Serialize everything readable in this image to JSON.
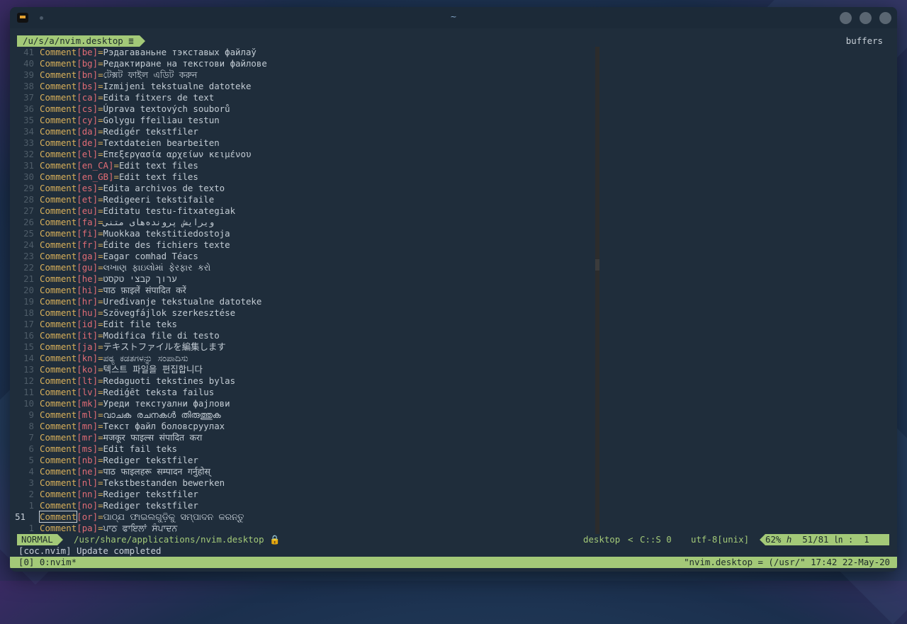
{
  "window": {
    "title": "~"
  },
  "tabline": {
    "path": "/u/s/a/nvim.desktop",
    "icon": "file-lines-icon",
    "buffers_label": "buffers"
  },
  "lines": [
    {
      "num": "41",
      "key": "Comment",
      "lang": "be",
      "val": "Рэдагаваньне тэкставых файлаў"
    },
    {
      "num": "40",
      "key": "Comment",
      "lang": "bg",
      "val": "Редактиране на текстови файлове"
    },
    {
      "num": "39",
      "key": "Comment",
      "lang": "bn",
      "val": "টেক্সট ফাইল এডিট করুন"
    },
    {
      "num": "38",
      "key": "Comment",
      "lang": "bs",
      "val": "Izmijeni tekstualne datoteke"
    },
    {
      "num": "37",
      "key": "Comment",
      "lang": "ca",
      "val": "Edita fitxers de text"
    },
    {
      "num": "36",
      "key": "Comment",
      "lang": "cs",
      "val": "Úprava textových souborů"
    },
    {
      "num": "35",
      "key": "Comment",
      "lang": "cy",
      "val": "Golygu ffeiliau testun"
    },
    {
      "num": "34",
      "key": "Comment",
      "lang": "da",
      "val": "Redigér tekstfiler"
    },
    {
      "num": "33",
      "key": "Comment",
      "lang": "de",
      "val": "Textdateien bearbeiten"
    },
    {
      "num": "32",
      "key": "Comment",
      "lang": "el",
      "val": "Επεξεργασία αρχείων κειμένου"
    },
    {
      "num": "31",
      "key": "Comment",
      "lang": "en_CA",
      "val": "Edit text files"
    },
    {
      "num": "30",
      "key": "Comment",
      "lang": "en_GB",
      "val": "Edit text files"
    },
    {
      "num": "29",
      "key": "Comment",
      "lang": "es",
      "val": "Edita archivos de texto"
    },
    {
      "num": "28",
      "key": "Comment",
      "lang": "et",
      "val": "Redigeeri tekstifaile"
    },
    {
      "num": "27",
      "key": "Comment",
      "lang": "eu",
      "val": "Editatu testu-fitxategiak"
    },
    {
      "num": "26",
      "key": "Comment",
      "lang": "fa",
      "val": "ویرایش پرونده‌های متنی"
    },
    {
      "num": "25",
      "key": "Comment",
      "lang": "fi",
      "val": "Muokkaa tekstitiedostoja"
    },
    {
      "num": "24",
      "key": "Comment",
      "lang": "fr",
      "val": "Édite des fichiers texte"
    },
    {
      "num": "23",
      "key": "Comment",
      "lang": "ga",
      "val": "Eagar comhad Téacs"
    },
    {
      "num": "22",
      "key": "Comment",
      "lang": "gu",
      "val": "લખાણ ફાઇલોમાં ફેરફાર કરો"
    },
    {
      "num": "21",
      "key": "Comment",
      "lang": "he",
      "val": "ערוך קבצי טקסט"
    },
    {
      "num": "20",
      "key": "Comment",
      "lang": "hi",
      "val": "पाठ फ़ाइलें संपादित करें"
    },
    {
      "num": "19",
      "key": "Comment",
      "lang": "hr",
      "val": "Uređivanje tekstualne datoteke"
    },
    {
      "num": "18",
      "key": "Comment",
      "lang": "hu",
      "val": "Szövegfájlok szerkesztése"
    },
    {
      "num": "17",
      "key": "Comment",
      "lang": "id",
      "val": "Edit file teks"
    },
    {
      "num": "16",
      "key": "Comment",
      "lang": "it",
      "val": "Modifica file di testo"
    },
    {
      "num": "15",
      "key": "Comment",
      "lang": "ja",
      "val": "テキストファイルを編集します"
    },
    {
      "num": "14",
      "key": "Comment",
      "lang": "kn",
      "val": "ಪಠ್ಯ ಕಡತಗಳನ್ನು ಸಂಪಾದಿಸು"
    },
    {
      "num": "13",
      "key": "Comment",
      "lang": "ko",
      "val": "텍스트 파일을 편집합니다"
    },
    {
      "num": "12",
      "key": "Comment",
      "lang": "lt",
      "val": "Redaguoti tekstines bylas"
    },
    {
      "num": "11",
      "key": "Comment",
      "lang": "lv",
      "val": "Rediģēt teksta failus"
    },
    {
      "num": "10",
      "key": "Comment",
      "lang": "mk",
      "val": "Уреди текстуални фајлови"
    },
    {
      "num": "9",
      "key": "Comment",
      "lang": "ml",
      "val": "വാചക രചനകള്‍ തിരുത്തുക"
    },
    {
      "num": "8",
      "key": "Comment",
      "lang": "mn",
      "val": "Текст файл боловсруулах"
    },
    {
      "num": "7",
      "key": "Comment",
      "lang": "mr",
      "val": "मजकूर फाइल्स संपादित करा"
    },
    {
      "num": "6",
      "key": "Comment",
      "lang": "ms",
      "val": "Edit fail teks"
    },
    {
      "num": "5",
      "key": "Comment",
      "lang": "nb",
      "val": "Rediger tekstfiler"
    },
    {
      "num": "4",
      "key": "Comment",
      "lang": "ne",
      "val": "पाठ फाइलहरू सम्पादन गर्नुहोस्"
    },
    {
      "num": "3",
      "key": "Comment",
      "lang": "nl",
      "val": "Tekstbestanden bewerken"
    },
    {
      "num": "2",
      "key": "Comment",
      "lang": "nn",
      "val": "Rediger tekstfiler"
    },
    {
      "num": "1",
      "key": "Comment",
      "lang": "no",
      "val": "Rediger tekstfiler"
    },
    {
      "num": "51",
      "key": "Comment",
      "lang": "or",
      "val": "ପାଠ୍ଯ ଫାଇଲଗୁଡ଼ିକୁ ସମ୍ପାଦନ କରନ୍ତୁ",
      "current": true
    },
    {
      "num": "1",
      "key": "Comment",
      "lang": "pa",
      "val": "ਪਾਠ ਫਾਇਲਾਂ ਸੰਪਾਦਨ"
    }
  ],
  "statusline": {
    "mode": "NORMAL",
    "path": "/usr/share/applications/nvim.desktop",
    "lock": "🔒",
    "filetype": "desktop",
    "separator": "<",
    "coc_status": "C::S 0",
    "encoding": "utf-8[unix]",
    "position": "62% ℎ  51/81 ㏑ :  1"
  },
  "message": "[coc.nvim] Update completed",
  "tmux": {
    "left": "[0] 0:nvim*",
    "right": "\"nvim.desktop = (/usr/\" 17:42 22-May-20"
  },
  "colors": {
    "accent_green": "#a3c978",
    "keyword": "#d9b05a",
    "bracket": "#e06c75",
    "terminal_bg": "#1f2d3b"
  }
}
